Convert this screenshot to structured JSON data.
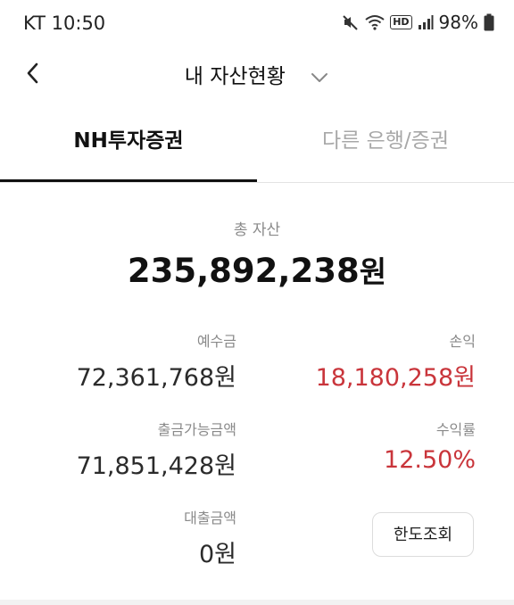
{
  "status_bar": {
    "time": "KT 10:50",
    "hd": "HD",
    "battery": "98%"
  },
  "header": {
    "title": "내 자산현황",
    "back_icon": "chevron-left-icon",
    "dropdown_icon": "chevron-down-icon"
  },
  "tabs": [
    {
      "label": "NH투자증권",
      "active": true
    },
    {
      "label": "다른 은행/증권",
      "active": false
    }
  ],
  "summary": {
    "total_label": "총 자산",
    "total_value": "235,892,238",
    "total_unit": "원"
  },
  "details": {
    "deposit_label": "예수금",
    "deposit_value": "72,361,768원",
    "profit_label": "손익",
    "profit_value": "18,180,258원",
    "withdrawable_label": "출금가능금액",
    "withdrawable_value": "71,851,428원",
    "return_rate_label": "수익률",
    "return_rate_value": "12.50%",
    "loan_label": "대출금액",
    "loan_value": "0원"
  },
  "actions": {
    "limit_inquiry_label": "한도조회"
  },
  "colors": {
    "profit": "#c9353b",
    "active_tab": "#111111",
    "inactive_tab": "#a8a8a8"
  }
}
